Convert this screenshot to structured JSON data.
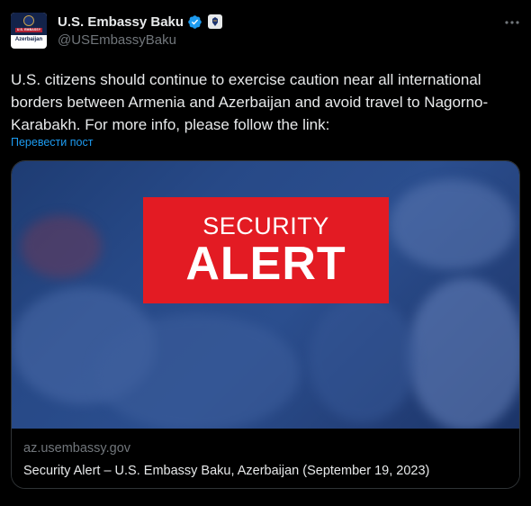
{
  "author": {
    "display_name": "U.S. Embassy Baku",
    "handle": "@USEmbassyBaku",
    "avatar_banner_text": "U.S. EMBASSY",
    "avatar_country": "Azerbaijan",
    "verified_icon": "verified-check-icon",
    "badge_icon": "government-badge-icon"
  },
  "tweet": {
    "text": "U.S. citizens should continue to exercise caution near all international borders between Armenia and Azerbaijan and avoid travel to Nagorno-Karabakh. For more info, please follow the link:",
    "translate_label": "Перевести пост"
  },
  "card": {
    "image_line1": "SECURITY",
    "image_line2": "ALERT",
    "domain": "az.usembassy.gov",
    "title": "Security Alert – U.S. Embassy Baku, Azerbaijan (September 19, 2023)"
  },
  "colors": {
    "background": "#000000",
    "link": "#1d9bf0",
    "verified": "#1d9bf0",
    "alert_red": "#e31b23"
  }
}
